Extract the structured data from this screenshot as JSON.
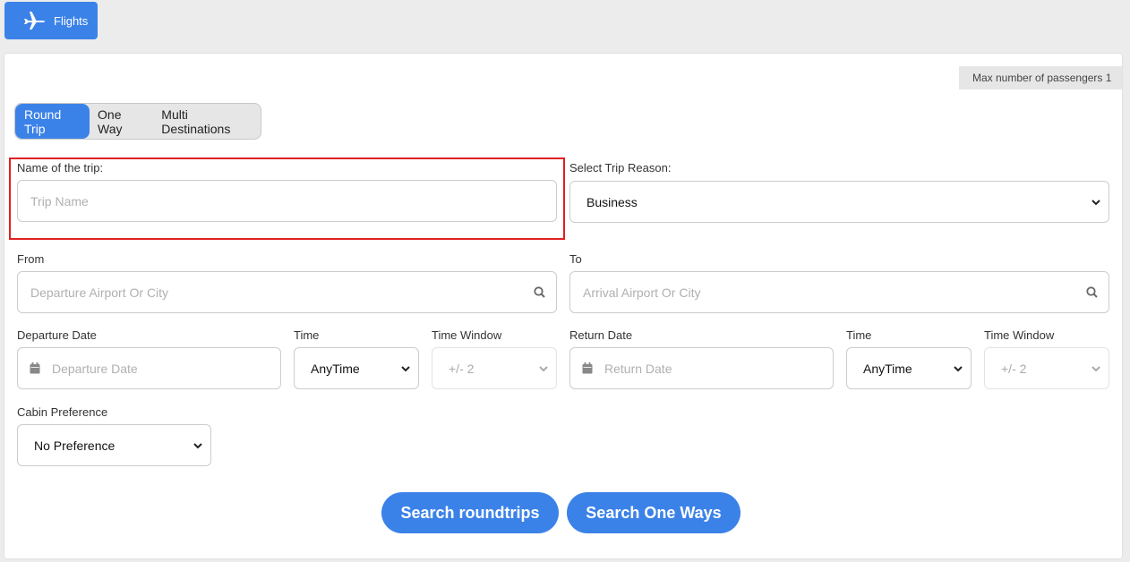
{
  "tab": {
    "label": "Flights",
    "icon": "airplane-icon"
  },
  "max_passengers": "Max number of passengers 1",
  "trip_types": [
    {
      "label": "Round Trip",
      "active": true
    },
    {
      "label": "One Way",
      "active": false
    },
    {
      "label": "Multi Destinations",
      "active": false
    }
  ],
  "trip_name": {
    "label": "Name of the trip:",
    "placeholder": "Trip Name"
  },
  "trip_reason": {
    "label": "Select Trip Reason:",
    "value": "Business"
  },
  "from": {
    "label": "From",
    "placeholder": "Departure Airport Or City"
  },
  "to": {
    "label": "To",
    "placeholder": "Arrival Airport Or City"
  },
  "departure": {
    "date_label": "Departure Date",
    "date_placeholder": "Departure Date",
    "time_label": "Time",
    "time_value": "AnyTime",
    "window_label": "Time Window",
    "window_value": "+/- 2"
  },
  "return": {
    "date_label": "Return Date",
    "date_placeholder": "Return Date",
    "time_label": "Time",
    "time_value": "AnyTime",
    "window_label": "Time Window",
    "window_value": "+/- 2"
  },
  "cabin": {
    "label": "Cabin Preference",
    "value": "No Preference"
  },
  "buttons": {
    "search_roundtrips": "Search roundtrips",
    "search_one_ways": "Search One Ways"
  },
  "colors": {
    "accent": "#3b82e8",
    "highlight": "#e02020"
  }
}
